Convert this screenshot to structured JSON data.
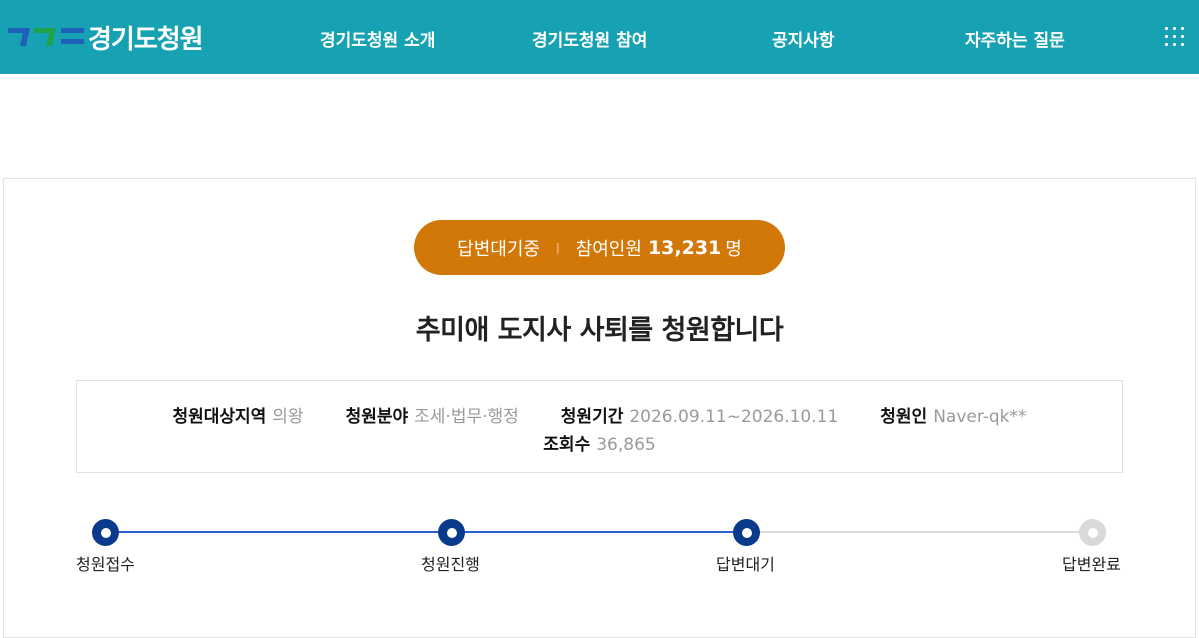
{
  "header": {
    "logo_text": "경기도청원",
    "logo_colors": [
      "#1f5fb8",
      "#1fa24a",
      "#1f5fb8"
    ],
    "nav": [
      {
        "label": "경기도청원 소개"
      },
      {
        "label": "경기도청원 참여"
      },
      {
        "label": "공지사항"
      },
      {
        "label": "자주하는 질문"
      }
    ],
    "menu_icon": "grid-menu-icon",
    "background": "#17a2b4"
  },
  "petition": {
    "status": "답변대기중",
    "participants_label": "참여인원",
    "participants_count": "13,231",
    "participants_unit": "명",
    "status_color": "#d27808",
    "title": "추미애 도지사 사퇴를 청원합니다",
    "info": {
      "region_label": "청원대상지역",
      "region_value": "의왕",
      "category_label": "청원분야",
      "category_value": "조세·법무·행정",
      "period_label": "청원기간",
      "period_value": "2026.09.11~2026.10.11",
      "author_label": "청원인",
      "author_value": "Naver-qk**",
      "views_label": "조회수",
      "views_value": "36,865"
    }
  },
  "progress": {
    "steps": [
      {
        "label": "청원접수",
        "state": "done"
      },
      {
        "label": "청원진행",
        "state": "done"
      },
      {
        "label": "답변대기",
        "state": "current"
      },
      {
        "label": "답변완료",
        "state": "pending"
      }
    ],
    "active_color": "#0a3a8c",
    "inactive_color": "#d9d9d9"
  }
}
